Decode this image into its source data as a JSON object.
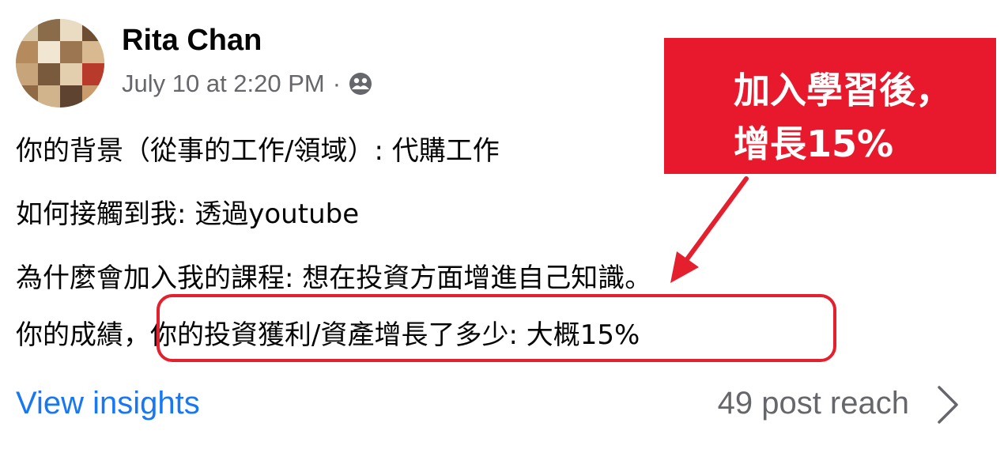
{
  "post": {
    "author": "Rita Chan",
    "date": "July 10 at 2:20 PM",
    "separator": "·",
    "audience_icon": "friends-icon"
  },
  "content": {
    "line1": "你的背景（從事的工作/領域）: 代購工作",
    "line2": "如何接觸到我: 透過youtube",
    "line3": "為什麼會加入我的課程: 想在投資方面增進自己知識。",
    "line4_prefix": "你的成績，",
    "line4_highlight": "你的投資獲利/資產增長了多少: 大概15%"
  },
  "callout": {
    "line1": "加入學習後，",
    "line2": "增長15%",
    "color": "#e8192c"
  },
  "footer": {
    "insights_label": "View insights",
    "reach_label": "49 post reach",
    "chevron_icon": "chevron-right-icon"
  },
  "colors": {
    "link": "#1877f2",
    "secondary": "#65676b",
    "highlight": "#e5202e"
  }
}
